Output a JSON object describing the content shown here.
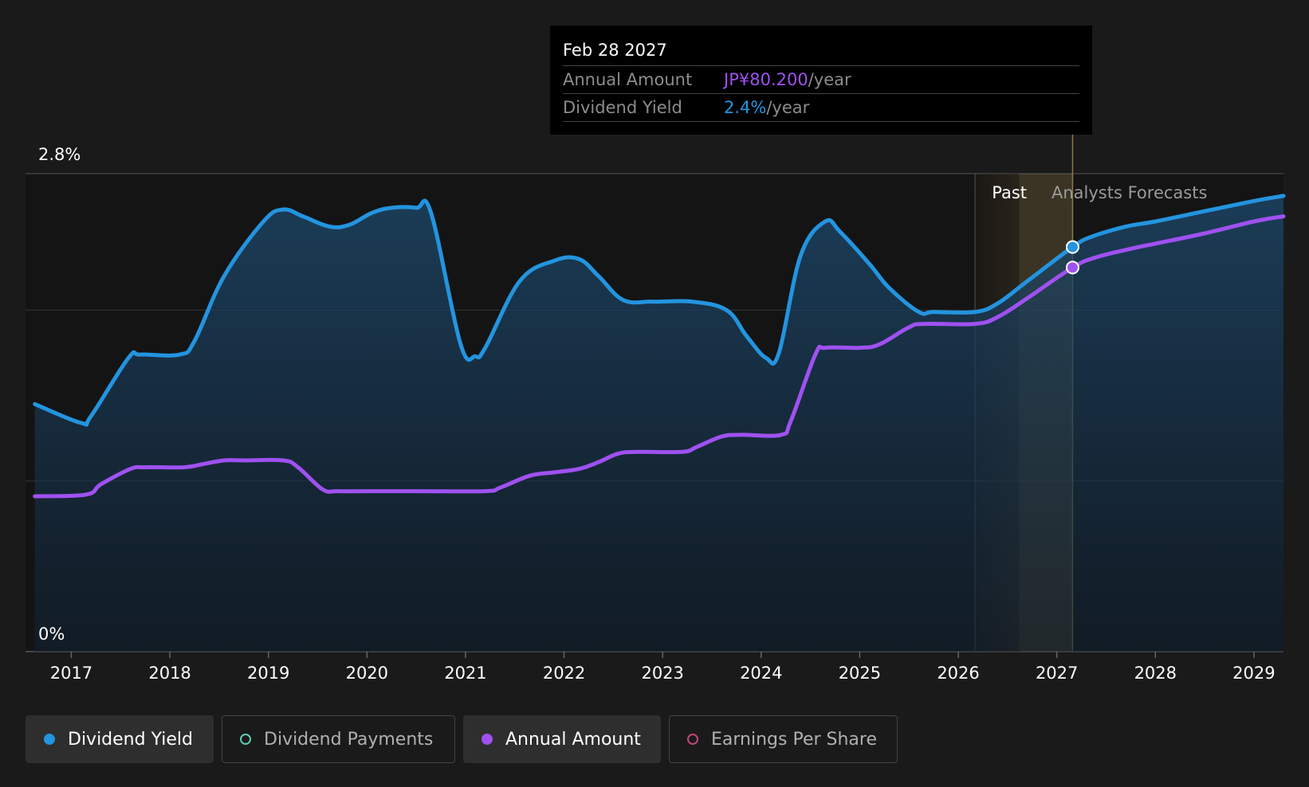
{
  "colors": {
    "background": "#1a1a1a",
    "dividend_yield": "#2394df",
    "annual_amount": "#9f51f0",
    "dividend_payments": "#5fc9b4",
    "earnings_per_share": "#c2457a",
    "forecast_band": "#c8a860"
  },
  "tooltip": {
    "date": "Feb 28 2027",
    "rows": [
      {
        "label": "Annual Amount",
        "value": "JP¥80.200",
        "unit": "/year",
        "color": "#9f51f0"
      },
      {
        "label": "Dividend Yield",
        "value": "2.4%",
        "unit": "/year",
        "color": "#2394df"
      }
    ]
  },
  "legend": [
    {
      "label": "Dividend Yield",
      "icon": "filled-dot",
      "color": "#2394df",
      "active": true
    },
    {
      "label": "Dividend Payments",
      "icon": "hollow-dot",
      "color": "#5fc9b4",
      "active": false
    },
    {
      "label": "Annual Amount",
      "icon": "filled-dot",
      "color": "#9f51f0",
      "active": true
    },
    {
      "label": "Earnings Per Share",
      "icon": "hollow-dot",
      "color": "#c2457a",
      "active": false
    }
  ],
  "chart_data": {
    "type": "line",
    "x_ticks": [
      2017,
      2018,
      2019,
      2020,
      2021,
      2022,
      2023,
      2024,
      2025,
      2026,
      2027,
      2028,
      2029
    ],
    "xlim": [
      2016.6,
      2029.3
    ],
    "ylim": [
      0,
      2.8
    ],
    "y_tick_labels": [
      {
        "value": 2.8,
        "label": "2.8%"
      },
      {
        "value": 0,
        "label": "0%"
      }
    ],
    "gridlines": [
      0,
      1.0,
      2.0,
      2.8
    ],
    "past_label": "Past",
    "forecast_label": "Analysts Forecasts",
    "past_end": 2026.17,
    "forecast_start": 2026.62,
    "hover_x": 2027.16,
    "grid": true,
    "series": [
      {
        "name": "Dividend Yield",
        "points": [
          [
            2016.63,
            1.45
          ],
          [
            2017.1,
            1.34
          ],
          [
            2017.2,
            1.38
          ],
          [
            2017.58,
            1.72
          ],
          [
            2017.7,
            1.74
          ],
          [
            2018.1,
            1.74
          ],
          [
            2018.25,
            1.82
          ],
          [
            2018.55,
            2.2
          ],
          [
            2018.95,
            2.52
          ],
          [
            2019.15,
            2.59
          ],
          [
            2019.35,
            2.55
          ],
          [
            2019.62,
            2.49
          ],
          [
            2019.82,
            2.5
          ],
          [
            2020.05,
            2.57
          ],
          [
            2020.25,
            2.6
          ],
          [
            2020.5,
            2.6
          ],
          [
            2020.65,
            2.57
          ],
          [
            2020.95,
            1.8
          ],
          [
            2021.1,
            1.73
          ],
          [
            2021.2,
            1.78
          ],
          [
            2021.55,
            2.17
          ],
          [
            2021.9,
            2.29
          ],
          [
            2022.15,
            2.3
          ],
          [
            2022.35,
            2.2
          ],
          [
            2022.6,
            2.06
          ],
          [
            2022.9,
            2.05
          ],
          [
            2023.3,
            2.05
          ],
          [
            2023.65,
            2.0
          ],
          [
            2023.85,
            1.85
          ],
          [
            2024.05,
            1.72
          ],
          [
            2024.18,
            1.75
          ],
          [
            2024.4,
            2.32
          ],
          [
            2024.65,
            2.52
          ],
          [
            2024.8,
            2.46
          ],
          [
            2025.1,
            2.27
          ],
          [
            2025.3,
            2.13
          ],
          [
            2025.6,
            1.99
          ],
          [
            2025.75,
            1.99
          ],
          [
            2026.17,
            1.99
          ],
          [
            2026.4,
            2.04
          ],
          [
            2026.7,
            2.17
          ],
          [
            2027.16,
            2.37
          ],
          [
            2027.35,
            2.43
          ],
          [
            2027.7,
            2.49
          ],
          [
            2028.0,
            2.52
          ],
          [
            2028.5,
            2.58
          ],
          [
            2029.0,
            2.64
          ],
          [
            2029.3,
            2.67
          ]
        ]
      },
      {
        "name": "Annual Amount",
        "points": [
          [
            2016.63,
            0.91
          ],
          [
            2017.15,
            0.92
          ],
          [
            2017.3,
            0.98
          ],
          [
            2017.6,
            1.07
          ],
          [
            2017.75,
            1.08
          ],
          [
            2018.15,
            1.08
          ],
          [
            2018.35,
            1.1
          ],
          [
            2018.55,
            1.12
          ],
          [
            2018.75,
            1.12
          ],
          [
            2019.15,
            1.12
          ],
          [
            2019.3,
            1.08
          ],
          [
            2019.55,
            0.95
          ],
          [
            2019.7,
            0.94
          ],
          [
            2020.0,
            0.94
          ],
          [
            2020.5,
            0.94
          ],
          [
            2021.2,
            0.94
          ],
          [
            2021.35,
            0.96
          ],
          [
            2021.65,
            1.03
          ],
          [
            2021.9,
            1.05
          ],
          [
            2022.15,
            1.07
          ],
          [
            2022.35,
            1.11
          ],
          [
            2022.55,
            1.16
          ],
          [
            2022.75,
            1.17
          ],
          [
            2023.2,
            1.17
          ],
          [
            2023.35,
            1.2
          ],
          [
            2023.6,
            1.26
          ],
          [
            2023.8,
            1.27
          ],
          [
            2024.2,
            1.27
          ],
          [
            2024.3,
            1.35
          ],
          [
            2024.55,
            1.74
          ],
          [
            2024.65,
            1.78
          ],
          [
            2025.0,
            1.78
          ],
          [
            2025.2,
            1.8
          ],
          [
            2025.5,
            1.9
          ],
          [
            2025.65,
            1.92
          ],
          [
            2026.17,
            1.92
          ],
          [
            2026.4,
            1.96
          ],
          [
            2026.7,
            2.07
          ],
          [
            2027.16,
            2.25
          ],
          [
            2027.4,
            2.31
          ],
          [
            2027.75,
            2.36
          ],
          [
            2028.0,
            2.39
          ],
          [
            2028.5,
            2.45
          ],
          [
            2029.0,
            2.52
          ],
          [
            2029.3,
            2.55
          ]
        ]
      }
    ]
  }
}
